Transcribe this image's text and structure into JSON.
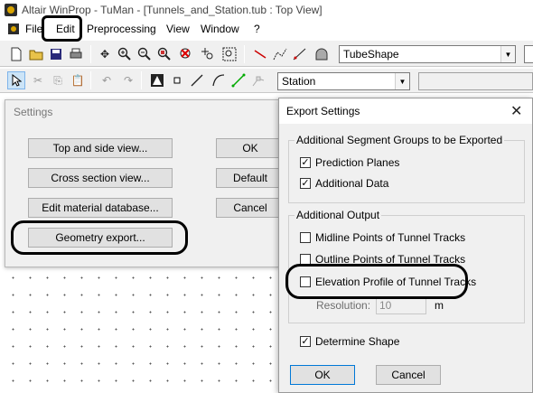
{
  "window": {
    "title": "Altair WinProp - TuMan - [Tunnels_and_Station.tub : Top View]"
  },
  "menu": {
    "items": [
      "File",
      "Edit",
      "Preprocessing",
      "View",
      "Window",
      "?"
    ]
  },
  "toolbar1": {
    "shape_select": "TubeShape"
  },
  "toolbar2": {
    "layer_select": "Station"
  },
  "settings_dialog": {
    "title": "Settings",
    "buttons": {
      "top_side_view": "Top and side view...",
      "cross_section_view": "Cross section view...",
      "edit_material_database": "Edit material database...",
      "geometry_export": "Geometry export...",
      "ok": "OK",
      "default": "Default",
      "cancel": "Cancel"
    }
  },
  "export_dialog": {
    "title": "Export Settings",
    "close_glyph": "✕",
    "group1": {
      "label": "Additional Segment Groups to be Exported",
      "items": [
        {
          "label": "Prediction Planes",
          "checked": true
        },
        {
          "label": "Additional Data",
          "checked": true
        }
      ]
    },
    "group2": {
      "label": "Additional Output",
      "items": [
        {
          "label": "Midline Points of Tunnel Tracks",
          "checked": false
        },
        {
          "label": "Outline Points of Tunnel Tracks",
          "checked": false
        },
        {
          "label": "Elevation Profile of Tunnel Tracks",
          "checked": false
        }
      ],
      "resolution_label": "Resolution:",
      "resolution_value": "10",
      "resolution_unit": "m"
    },
    "determine_shape": {
      "label": "Determine Shape",
      "checked": true
    },
    "buttons": {
      "ok": "OK",
      "cancel": "Cancel"
    }
  },
  "colors": {
    "dialog_bg": "#f0f0f0",
    "annotation": "#000000"
  }
}
